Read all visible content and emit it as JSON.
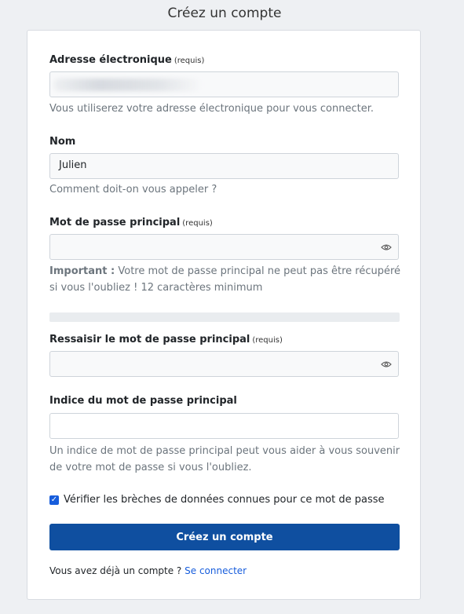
{
  "page": {
    "title": "Créez un compte"
  },
  "form": {
    "email": {
      "label": "Adresse électronique",
      "required": "(requis)",
      "help": "Vous utiliserez votre adresse électronique pour vous connecter.",
      "value": ""
    },
    "name": {
      "label": "Nom",
      "value": "Julien",
      "help": "Comment doit-on vous appeler ?"
    },
    "master_password": {
      "label": "Mot de passe principal",
      "required": "(requis)",
      "help_strong": "Important :",
      "help_text": " Votre mot de passe principal ne peut pas être récupéré si vous l'oubliez ! 12 caractères minimum",
      "value": ""
    },
    "retype_password": {
      "label": "Ressaisir le mot de passe principal",
      "required": "(requis)",
      "value": ""
    },
    "hint": {
      "label": "Indice du mot de passe principal",
      "help": "Un indice de mot de passe principal peut vous aider à vous souvenir de votre mot de passe si vous l'oubliez.",
      "value": ""
    },
    "breach_check": {
      "label": "Vérifier les brèches de données connues pour ce mot de passe",
      "checked": true
    },
    "submit_label": "Créez un compte"
  },
  "footer": {
    "text": "Vous avez déjà un compte ?",
    "link": "Se connecter"
  },
  "colors": {
    "primary": "#175ddc",
    "button": "#0f4fa0",
    "background": "#eef0f3"
  }
}
